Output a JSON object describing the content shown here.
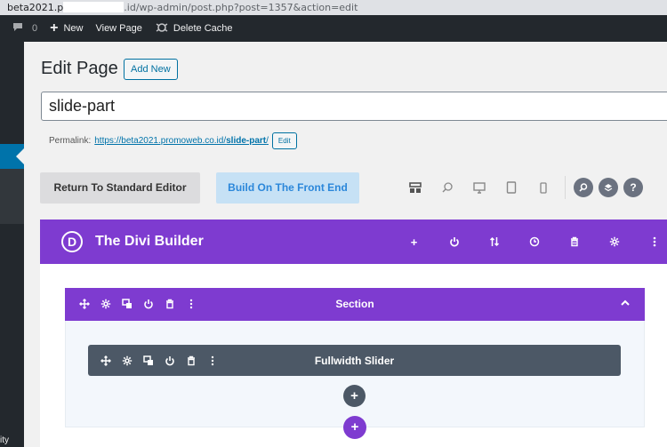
{
  "browser": {
    "url_prefix": "beta2021.p",
    "url_suffix": ".id/wp-admin/post.php?post=1357&action=edit"
  },
  "admin_bar": {
    "comments_count": "0",
    "new_label": "New",
    "view_page_label": "View Page",
    "delete_cache_label": "Delete Cache"
  },
  "sidebar": {
    "fragment_text": "ity"
  },
  "page": {
    "heading": "Edit Page",
    "add_new_label": "Add New",
    "title_value": "slide-part",
    "permalink_label": "Permalink:",
    "permalink_base": "https://beta2021.promoweb.co.id/",
    "permalink_slug": "slide-part",
    "permalink_trailing": "/",
    "permalink_edit_label": "Edit"
  },
  "editor_buttons": {
    "standard_label": "Return To Standard Editor",
    "front_end_label": "Build On The Front End"
  },
  "view_icons": [
    "wireframe-view-icon",
    "zoom-out-icon",
    "desktop-view-icon",
    "tablet-view-icon",
    "phone-view-icon"
  ],
  "round_icons": [
    "search-icon",
    "layers-icon",
    "help-icon"
  ],
  "divi": {
    "logo_letter": "D",
    "title": "The Divi Builder",
    "toolbar_icons": [
      "add-icon",
      "power-icon",
      "sort-icon",
      "history-icon",
      "trash-icon",
      "settings-icon",
      "more-icon"
    ]
  },
  "section": {
    "label": "Section",
    "tools": [
      "move-icon",
      "settings-icon",
      "duplicate-icon",
      "power-icon",
      "trash-icon",
      "more-icon"
    ]
  },
  "module": {
    "label": "Fullwidth Slider",
    "tools": [
      "move-icon",
      "settings-icon",
      "duplicate-icon",
      "power-icon",
      "trash-icon",
      "more-icon"
    ]
  },
  "colors": {
    "divi_purple": "#7e3bd0",
    "module_gray": "#4c5866",
    "wp_admin_dark": "#23282d",
    "wp_blue": "#0073aa"
  }
}
